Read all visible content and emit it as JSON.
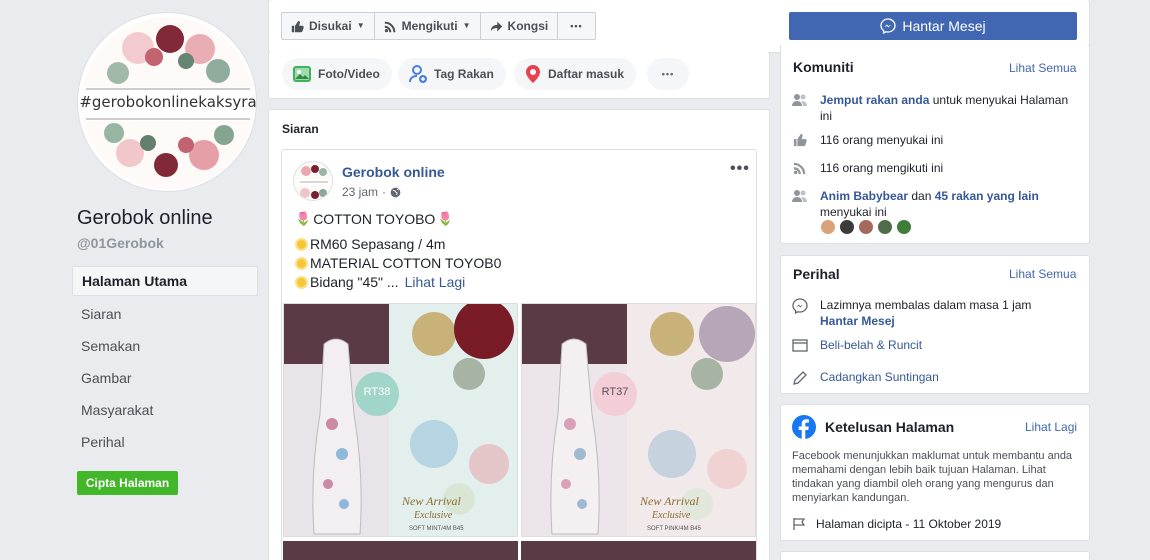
{
  "profile": {
    "avatar_text": "#gerobokonlinekaksyra",
    "name": "Gerobok online",
    "handle": "@01Gerobok"
  },
  "nav": {
    "items": [
      {
        "label": "Halaman Utama",
        "active": true
      },
      {
        "label": "Siaran"
      },
      {
        "label": "Semakan"
      },
      {
        "label": "Gambar"
      },
      {
        "label": "Masyarakat"
      },
      {
        "label": "Perihal"
      }
    ],
    "create_page": "Cipta Halaman"
  },
  "actions": {
    "like": "Disukai",
    "follow": "Mengikuti",
    "share": "Kongsi",
    "more": "•••",
    "message": "Hantar Mesej"
  },
  "composer": {
    "photo": "Foto/Video",
    "tag": "Tag Rakan",
    "checkin": "Daftar masuk",
    "more": "•••"
  },
  "posts": {
    "title": "Siaran",
    "post": {
      "author": "Gerobok online",
      "time": "23 jam",
      "line1": "COTTON TOYOBO",
      "line2": "RM60 Sepasang / 4m",
      "line3": "MATERIAL COTTON TOYOB0",
      "line4": "Bidang \"45\" ...",
      "see_more": "Lihat Lagi",
      "photo1_code": "RT38",
      "photo2_code": "RT37",
      "photo_caption1": "New Arrival",
      "photo_caption2": "Exclusive",
      "photo1_sub": "SOFT MINT/4M B45",
      "photo2_sub": "SOFT PINK/4M B45"
    }
  },
  "community": {
    "title": "Komuniti",
    "see_all": "Lihat Semua",
    "invite_link": "Jemput rakan anda",
    "invite_rest": "untuk menyukai Halaman ini",
    "likes": "116 orang menyukai ini",
    "follows": "116 orang mengikuti ini",
    "friend_name": "Anim Babybear",
    "friend_mid": "dan",
    "friend_others": "45 rakan yang lain",
    "friend_rest": "menyukai ini"
  },
  "about": {
    "title": "Perihal",
    "see_all": "Lihat Semua",
    "response": "Lazimnya membalas dalam masa 1 jam",
    "send_msg": "Hantar Mesej",
    "category": "Beli-belah & Runcit",
    "suggest": "Cadangkan Suntingan"
  },
  "transparency": {
    "title": "Ketelusan Halaman",
    "see_more": "Lihat Lagi",
    "desc": "Facebook menunjukkan maklumat untuk membantu anda memahami dengan lebih baik tujuan Halaman. Lihat tindakan yang diambil oleh orang yang mengurus dan menyiarkan kandungan.",
    "created": "Halaman dicipta - 11 Oktober 2019"
  },
  "colors": {
    "brand": "#4267b2",
    "link": "#365899",
    "green": "#42b72a",
    "background": "#e9ebee"
  }
}
